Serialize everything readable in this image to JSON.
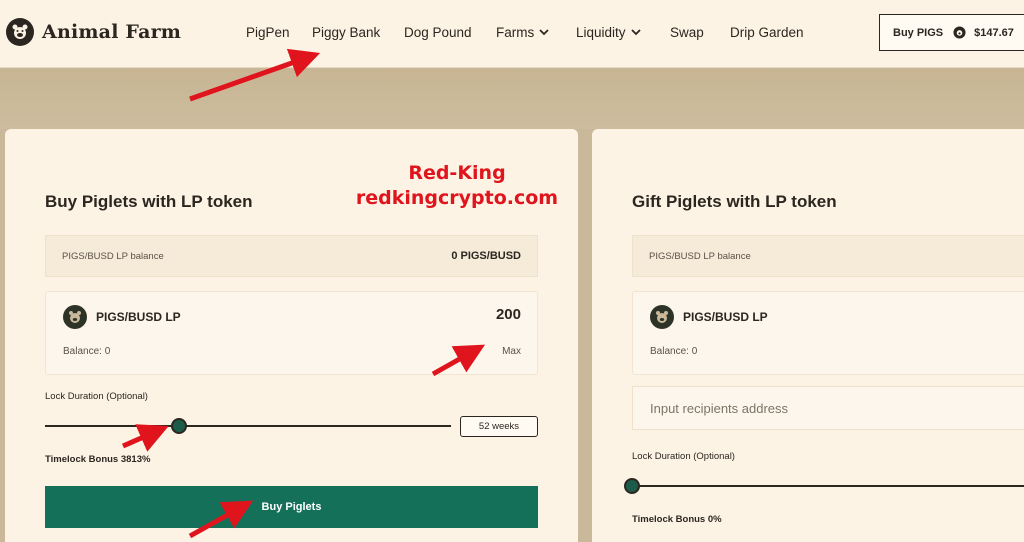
{
  "header": {
    "logo_text": "Animal Farm",
    "nav": [
      {
        "label": "PigPen"
      },
      {
        "label": "Piggy Bank"
      },
      {
        "label": "Dog Pound"
      },
      {
        "label": "Farms",
        "dropdown": true
      },
      {
        "label": "Liquidity",
        "dropdown": true
      },
      {
        "label": "Swap"
      },
      {
        "label": "Drip Garden"
      }
    ],
    "buy_label": "Buy PIGS",
    "price": "$147.67"
  },
  "buy_card": {
    "title": "Buy Piglets with LP token",
    "balance_label": "PIGS/BUSD LP balance",
    "balance_value": "0 PIGS/BUSD",
    "token_name": "PIGS/BUSD LP",
    "amount": "200",
    "balance_text": "Balance: 0",
    "max_label": "Max",
    "lock_label": "Lock Duration (Optional)",
    "lock_value": "52 weeks",
    "lock_level": 0.33,
    "bonus_text": "Timelock Bonus 3813%",
    "button_label": "Buy Piglets"
  },
  "gift_card": {
    "title": "Gift Piglets with LP token",
    "balance_label": "PIGS/BUSD LP balance",
    "token_name": "PIGS/BUSD LP",
    "balance_text": "Balance: 0",
    "recipient_placeholder": "Input recipients address",
    "lock_label": "Lock Duration (Optional)",
    "lock_level": 0,
    "bonus_text": "Timelock Bonus 0%"
  },
  "watermark": {
    "line1": "Red-King",
    "line2": "redkingcrypto.com"
  },
  "colors": {
    "accent": "#15705a",
    "background": "#fdf3e4",
    "annotation": "#e0141d"
  }
}
